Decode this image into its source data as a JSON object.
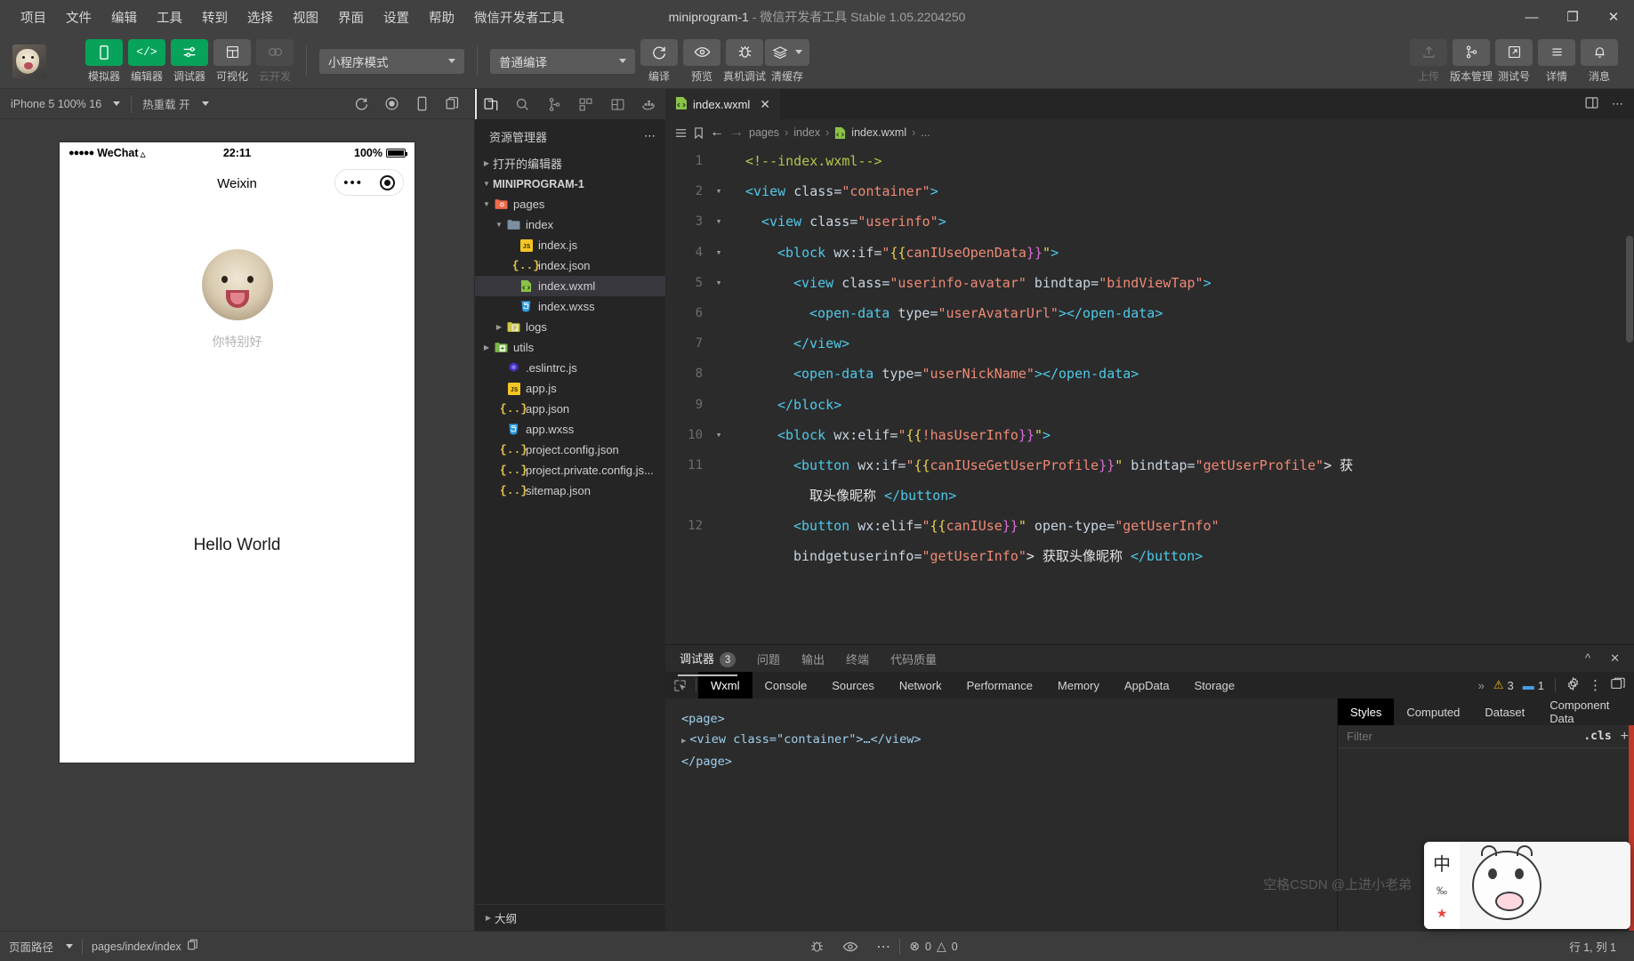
{
  "titlebar": {
    "menus": [
      "项目",
      "文件",
      "编辑",
      "工具",
      "转到",
      "选择",
      "视图",
      "界面",
      "设置",
      "帮助",
      "微信开发者工具"
    ],
    "project": "miniprogram-1",
    "dash": " - ",
    "app_version": "微信开发者工具 Stable 1.05.2204250",
    "minimize": "—",
    "maximize": "❐",
    "close": "✕"
  },
  "toolbar": {
    "buttons": [
      {
        "label": "模拟器",
        "icon": "phone-icon",
        "state": "green"
      },
      {
        "label": "编辑器",
        "icon": "code-icon",
        "state": "green"
      },
      {
        "label": "调试器",
        "icon": "debugger-icon",
        "state": "green"
      },
      {
        "label": "可视化",
        "icon": "layout-icon",
        "state": "grey"
      },
      {
        "label": "云开发",
        "icon": "cloud-icon",
        "state": "disabled"
      }
    ],
    "mode_select": "小程序模式",
    "compile_select": "普通编译",
    "actions": [
      {
        "label": "编译",
        "icon": "refresh-icon"
      },
      {
        "label": "预览",
        "icon": "eye-icon"
      },
      {
        "label": "真机调试",
        "icon": "bug-icon"
      },
      {
        "label": "清缓存",
        "icon": "layers-icon"
      }
    ],
    "right_actions": [
      {
        "label": "上传",
        "icon": "upload-icon",
        "disabled": true
      },
      {
        "label": "版本管理",
        "icon": "git-branch-icon",
        "disabled": false
      },
      {
        "label": "测试号",
        "icon": "external-link-icon",
        "disabled": false
      },
      {
        "label": "详情",
        "icon": "menu-icon",
        "disabled": false
      },
      {
        "label": "消息",
        "icon": "bell-icon",
        "disabled": false
      }
    ]
  },
  "simulator": {
    "device": "iPhone 5 100% 16",
    "hotreload": "热重载 开",
    "phone": {
      "carrier": "WeChat",
      "dots": "●●●●●",
      "time": "22:11",
      "battery": "100%",
      "nav_title": "Weixin",
      "nickname": "你特别好",
      "hello": "Hello World"
    }
  },
  "explorer": {
    "title": "资源管理器",
    "open_editors": "打开的编辑器",
    "project_root": "MINIPROGRAM-1",
    "outline": "大纲",
    "tree": [
      {
        "label": "pages",
        "icon": "folder-pages-icon",
        "depth": 1,
        "type": "folder",
        "open": true
      },
      {
        "label": "index",
        "icon": "folder-icon",
        "depth": 2,
        "type": "folder",
        "open": true
      },
      {
        "label": "index.js",
        "icon": "js-icon",
        "depth": 3,
        "type": "file"
      },
      {
        "label": "index.json",
        "icon": "json-icon",
        "depth": 3,
        "type": "file"
      },
      {
        "label": "index.wxml",
        "icon": "wxml-icon",
        "depth": 3,
        "type": "file",
        "active": true
      },
      {
        "label": "index.wxss",
        "icon": "wxss-icon",
        "depth": 3,
        "type": "file"
      },
      {
        "label": "logs",
        "icon": "folder-logs-icon",
        "depth": 2,
        "type": "folder",
        "open": false
      },
      {
        "label": "utils",
        "icon": "folder-utils-icon",
        "depth": 1,
        "type": "folder",
        "open": false
      },
      {
        "label": ".eslintrc.js",
        "icon": "eslint-icon",
        "depth": 2,
        "type": "file"
      },
      {
        "label": "app.js",
        "icon": "js-icon",
        "depth": 2,
        "type": "file"
      },
      {
        "label": "app.json",
        "icon": "json-icon",
        "depth": 2,
        "type": "file"
      },
      {
        "label": "app.wxss",
        "icon": "wxss-icon",
        "depth": 2,
        "type": "file"
      },
      {
        "label": "project.config.json",
        "icon": "json-icon",
        "depth": 2,
        "type": "file"
      },
      {
        "label": "project.private.config.js...",
        "icon": "json-icon",
        "depth": 2,
        "type": "file"
      },
      {
        "label": "sitemap.json",
        "icon": "json-icon",
        "depth": 2,
        "type": "file"
      }
    ]
  },
  "editor": {
    "tab": "index.wxml",
    "breadcrumb": [
      "pages",
      "index",
      "index.wxml",
      "..."
    ],
    "lines": [
      {
        "n": "1",
        "fold": "",
        "parts": [
          {
            "t": "<!--index.wxml-->",
            "c": "cm"
          }
        ],
        "indent": 0
      },
      {
        "n": "2",
        "fold": "v",
        "parts": [
          {
            "t": "<view ",
            "c": "tg"
          },
          {
            "t": "class=",
            "c": "at"
          },
          {
            "t": "\"container\"",
            "c": "st"
          },
          {
            "t": ">",
            "c": "tg"
          }
        ],
        "indent": 0
      },
      {
        "n": "3",
        "fold": "v",
        "parts": [
          {
            "t": "<view ",
            "c": "tg"
          },
          {
            "t": "class=",
            "c": "at"
          },
          {
            "t": "\"userinfo\"",
            "c": "st"
          },
          {
            "t": ">",
            "c": "tg"
          }
        ],
        "indent": 1
      },
      {
        "n": "4",
        "fold": "v",
        "parts": [
          {
            "t": "<block ",
            "c": "tg"
          },
          {
            "t": "wx:if=",
            "c": "at"
          },
          {
            "t": "\"",
            "c": "st"
          },
          {
            "t": "{{",
            "c": "br1"
          },
          {
            "t": "canIUseOpenData",
            "c": "st"
          },
          {
            "t": "}}",
            "c": "br2"
          },
          {
            "t": "\"",
            "c": "br1"
          },
          {
            "t": ">",
            "c": "tg"
          }
        ],
        "indent": 2
      },
      {
        "n": "5",
        "fold": "v",
        "parts": [
          {
            "t": "<view ",
            "c": "tg"
          },
          {
            "t": "class=",
            "c": "at"
          },
          {
            "t": "\"userinfo-avatar\"",
            "c": "st"
          },
          {
            "t": " bindtap=",
            "c": "at"
          },
          {
            "t": "\"bindViewTap\"",
            "c": "st"
          },
          {
            "t": ">",
            "c": "tg"
          }
        ],
        "indent": 3
      },
      {
        "n": "6",
        "fold": "",
        "parts": [
          {
            "t": "<open-data ",
            "c": "tg"
          },
          {
            "t": "type=",
            "c": "at"
          },
          {
            "t": "\"userAvatarUrl\"",
            "c": "st"
          },
          {
            "t": "></open-data>",
            "c": "tg"
          }
        ],
        "indent": 4
      },
      {
        "n": "7",
        "fold": "",
        "parts": [
          {
            "t": "</view>",
            "c": "tg"
          }
        ],
        "indent": 3
      },
      {
        "n": "8",
        "fold": "",
        "parts": [
          {
            "t": "<open-data ",
            "c": "tg"
          },
          {
            "t": "type=",
            "c": "at"
          },
          {
            "t": "\"userNickName\"",
            "c": "st"
          },
          {
            "t": "></open-data>",
            "c": "tg"
          }
        ],
        "indent": 3
      },
      {
        "n": "9",
        "fold": "",
        "parts": [
          {
            "t": "</block>",
            "c": "tg"
          }
        ],
        "indent": 2
      },
      {
        "n": "10",
        "fold": "v",
        "parts": [
          {
            "t": "<block ",
            "c": "tg"
          },
          {
            "t": "wx:elif=",
            "c": "at"
          },
          {
            "t": "\"",
            "c": "st"
          },
          {
            "t": "{{",
            "c": "br1"
          },
          {
            "t": "!hasUserInfo",
            "c": "st"
          },
          {
            "t": "}}",
            "c": "br2"
          },
          {
            "t": "\"",
            "c": "br1"
          },
          {
            "t": ">",
            "c": "tg"
          }
        ],
        "indent": 2
      },
      {
        "n": "11",
        "fold": "",
        "parts": [
          {
            "t": "<button ",
            "c": "tg"
          },
          {
            "t": "wx:if=",
            "c": "at"
          },
          {
            "t": "\"",
            "c": "st"
          },
          {
            "t": "{{",
            "c": "br1"
          },
          {
            "t": "canIUseGetUserProfile",
            "c": "st"
          },
          {
            "t": "}}",
            "c": "br2"
          },
          {
            "t": "\"",
            "c": "br1"
          },
          {
            "t": " bindtap=",
            "c": "at"
          },
          {
            "t": "\"getUserProfile\"",
            "c": "st"
          },
          {
            "t": "> 获",
            "c": "wh"
          }
        ],
        "indent": 3
      },
      {
        "n": "",
        "fold": "",
        "parts": [
          {
            "t": "取头像昵称 ",
            "c": "wh"
          },
          {
            "t": "</button>",
            "c": "tg"
          }
        ],
        "indent": 4
      },
      {
        "n": "12",
        "fold": "",
        "parts": [
          {
            "t": "<button ",
            "c": "tg"
          },
          {
            "t": "wx:elif=",
            "c": "at"
          },
          {
            "t": "\"",
            "c": "st"
          },
          {
            "t": "{{",
            "c": "br1"
          },
          {
            "t": "canIUse",
            "c": "st"
          },
          {
            "t": "}}",
            "c": "br2"
          },
          {
            "t": "\"",
            "c": "br1"
          },
          {
            "t": " open-type=",
            "c": "at"
          },
          {
            "t": "\"getUserInfo\"",
            "c": "st"
          }
        ],
        "indent": 3
      },
      {
        "n": "",
        "fold": "",
        "parts": [
          {
            "t": "bindgetuserinfo=",
            "c": "at"
          },
          {
            "t": "\"getUserInfo\"",
            "c": "st"
          },
          {
            "t": "> 获取头像昵称 ",
            "c": "wh"
          },
          {
            "t": "</button>",
            "c": "tg"
          }
        ],
        "indent": 3
      }
    ]
  },
  "devtools": {
    "panels": [
      {
        "label": "调试器",
        "badge": "3",
        "selected": true
      },
      {
        "label": "问题",
        "badge": "",
        "selected": false
      },
      {
        "label": "输出",
        "badge": "",
        "selected": false
      },
      {
        "label": "终端",
        "badge": "",
        "selected": false
      },
      {
        "label": "代码质量",
        "badge": "",
        "selected": false
      }
    ],
    "collapse_icon": "chevron-up-icon",
    "close_icon": "close-icon",
    "tabs": [
      "Wxml",
      "Console",
      "Sources",
      "Network",
      "Performance",
      "Memory",
      "AppData",
      "Storage"
    ],
    "selected_tab": "Wxml",
    "overflow": "»",
    "warn_count": "3",
    "msg_count": "1",
    "dom_lines": [
      "<page>",
      "<view class=\"container\">…</view>",
      "</page>"
    ],
    "dom_root": "<page>",
    "dom_child": "<view class=\"container\">…</view>",
    "dom_end": "</page>",
    "style_tabs": [
      "Styles",
      "Computed",
      "Dataset",
      "Component Data"
    ],
    "style_selected": "Styles",
    "style_overflow": "»",
    "filter_placeholder": "Filter",
    "cls_label": ".cls",
    "plus_label": "+"
  },
  "statusbar": {
    "page_path_label": "页面路径",
    "page_path_value": "pages/index/index",
    "problems_errors": "0",
    "problems_warnings": "0",
    "cursor": "行 1, 列 1",
    "copy_icon": "copy-icon",
    "bug_icon": "bug-icon",
    "eye_icon": "eye-icon",
    "more_icon": "more-icon"
  },
  "ime": {
    "lang": "中",
    "punct": "‰",
    "star": "★"
  },
  "watermark": "空格CSDN @上进小老弟"
}
